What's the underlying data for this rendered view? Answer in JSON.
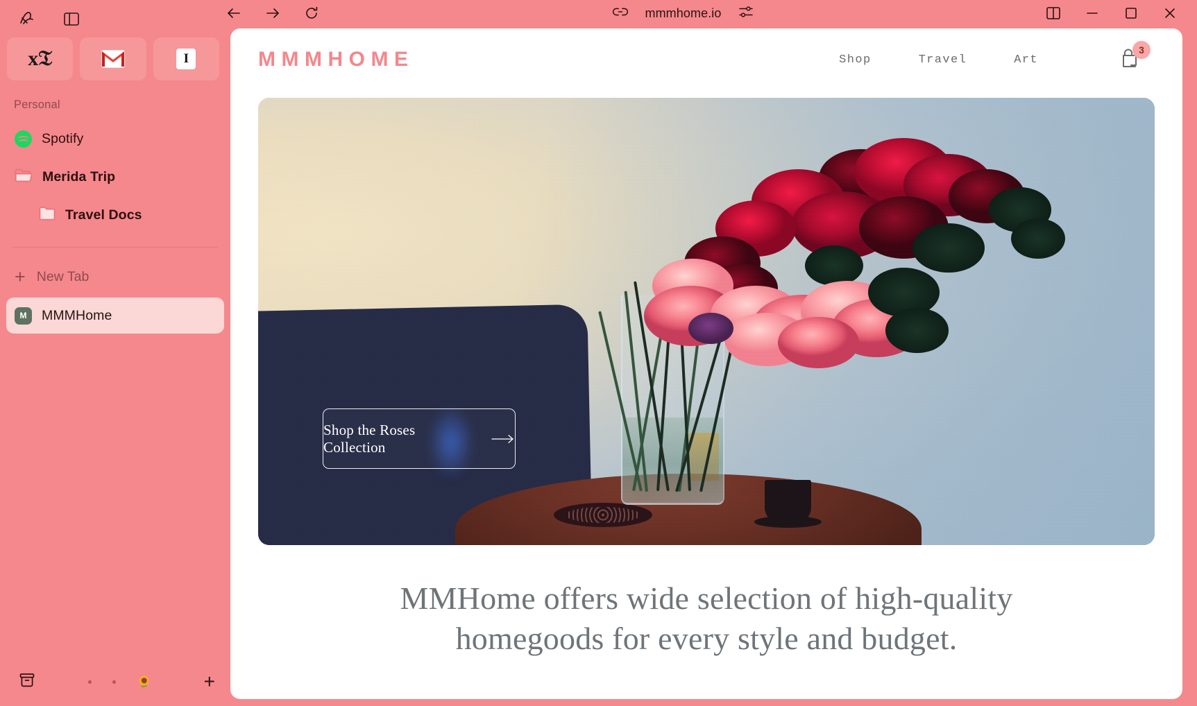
{
  "browser": {
    "app_icon": "arc-logo-icon",
    "sidebar_toggle_icon": "sidebar-toggle-icon",
    "pinned_tabs": [
      {
        "name": "new-york-times",
        "glyph": "Ŧ"
      },
      {
        "name": "gmail",
        "glyph": "M"
      },
      {
        "name": "instapaper",
        "glyph": "I"
      }
    ],
    "toolbar": {
      "back_icon": "back-arrow-icon",
      "forward_icon": "forward-arrow-icon",
      "reload_icon": "reload-icon",
      "link_icon": "copy-link-icon",
      "url": "mmmhome.io",
      "settings_icon": "page-settings-icon",
      "split_view_icon": "split-view-icon",
      "minimize_icon": "minimize-icon",
      "maximize_icon": "maximize-icon",
      "close_icon": "close-icon"
    },
    "sidebar": {
      "section_label": "Personal",
      "items": [
        {
          "label": "Spotify",
          "icon": "spotify-icon",
          "type": "tab"
        },
        {
          "label": "Merida Trip",
          "icon": "folder-open-icon",
          "type": "folder"
        },
        {
          "label": "Travel Docs",
          "icon": "folder-icon",
          "type": "folder-nested"
        }
      ],
      "new_tab_label": "New Tab",
      "active_tab": {
        "label": "MMMHome",
        "favicon_letter": "M"
      },
      "bottom": {
        "archive_icon": "archive-icon",
        "space_dots": 2,
        "space_emoji": "🌻",
        "new_space_icon": "plus-icon"
      }
    }
  },
  "site": {
    "brand": "MMMHOME",
    "nav": [
      {
        "label": "Shop"
      },
      {
        "label": "Travel"
      },
      {
        "label": "Art"
      }
    ],
    "cart": {
      "icon": "shopping-bag-icon",
      "count": "3"
    },
    "hero": {
      "alt": "bouquet of red roses and pink peonies in a glass vase on a wooden side table",
      "cta_label": "Shop the Roses Collection",
      "cta_arrow": "arrow-right-icon"
    },
    "tagline": "MMHome offers wide selection of high-quality homegoods for every style and budget."
  },
  "colors": {
    "sidebar_bg": "#F5888C",
    "brand_pink": "#F4878B",
    "active_tab_bg": "#FBD7D6",
    "badge_bg": "#F9A7A7",
    "badge_text": "#8C2B2B",
    "tagline_text": "#6E7478",
    "nav_text": "#6B6B6B"
  }
}
